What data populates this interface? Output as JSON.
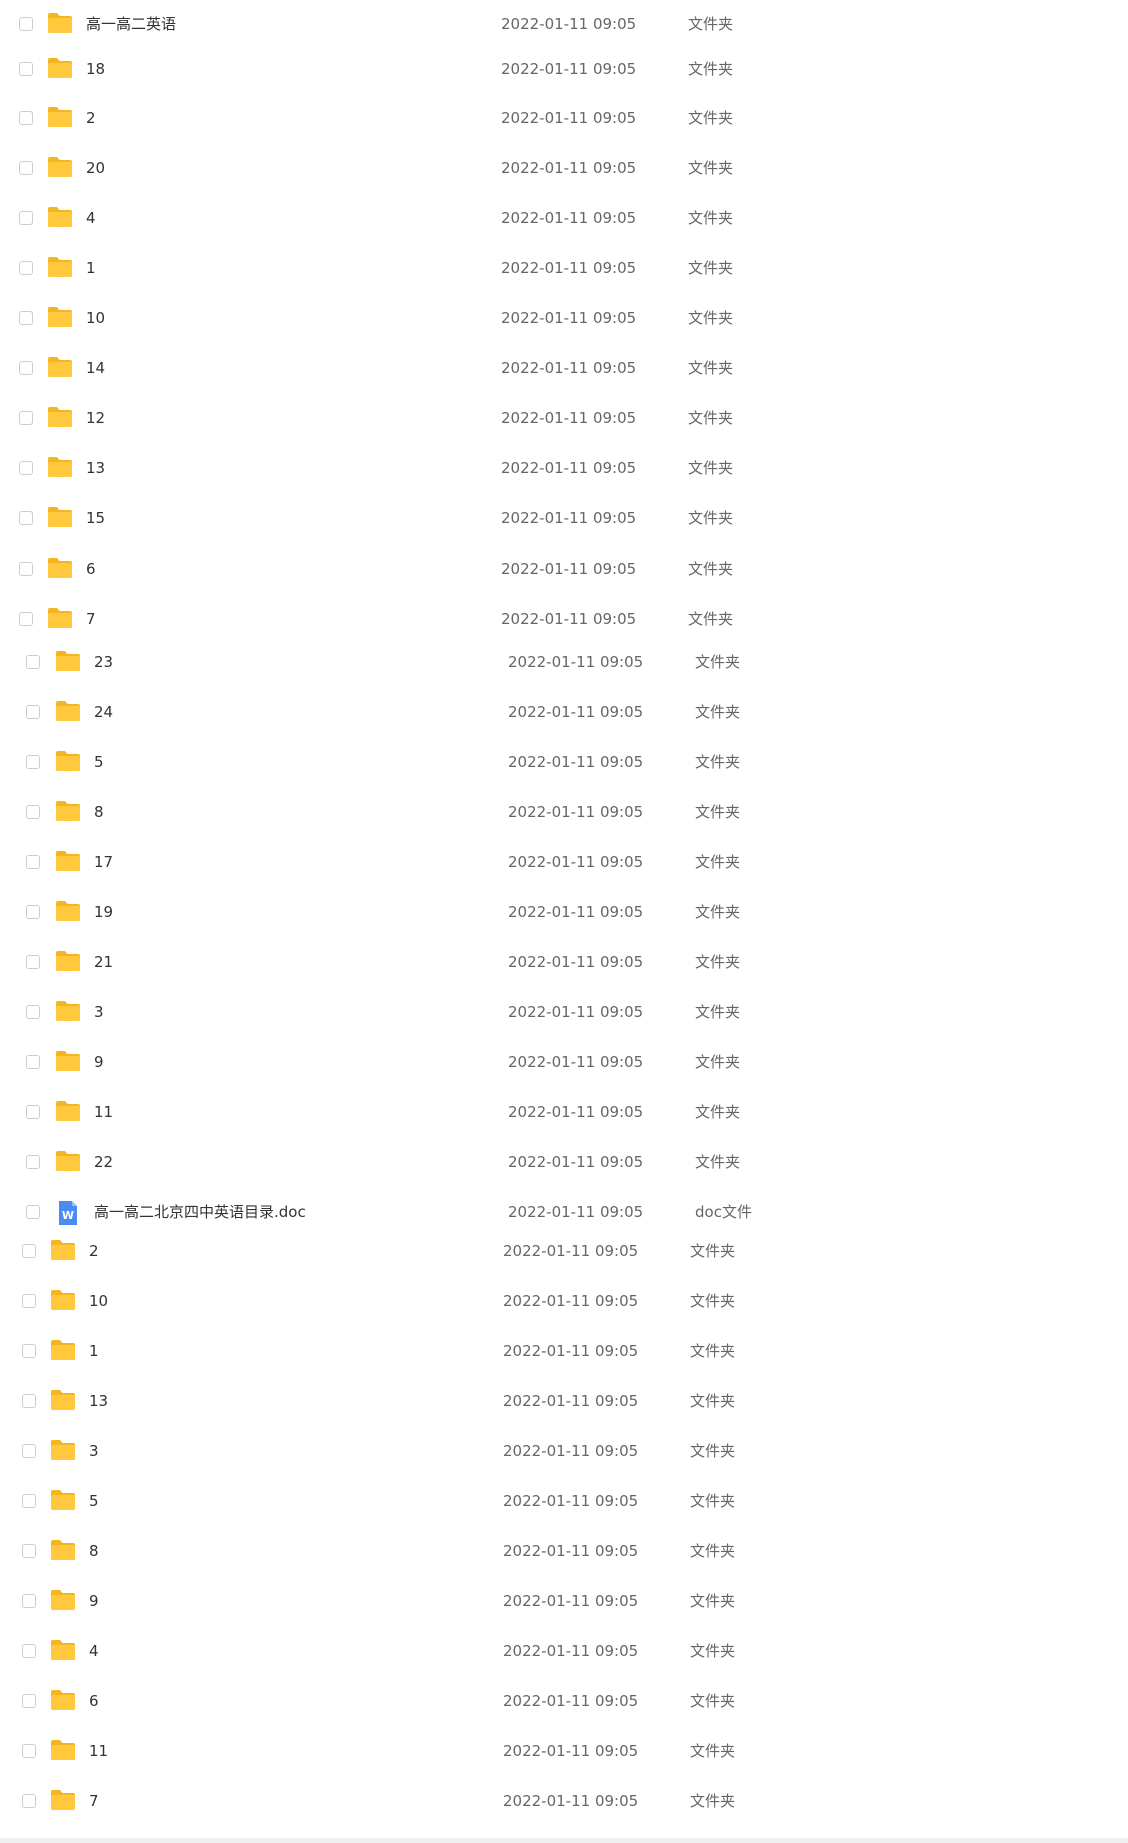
{
  "colors": {
    "folder": "#FFC83D",
    "folder_tab": "#F5B520",
    "doc_icon": "#4C8BF5",
    "date_text": "#666666",
    "name_text": "#333333"
  },
  "icons": {
    "folder": "folder-icon",
    "doc": "word-doc-icon",
    "checkbox": "checkbox"
  },
  "rows": [
    {
      "name": "高一高二英语",
      "date": "2022-01-11 09:05",
      "type": "文件夹"
    },
    {
      "name": "18",
      "date": "2022-01-11 09:05",
      "type": "文件夹"
    },
    {
      "name": "2",
      "date": "2022-01-11 09:05",
      "type": "文件夹"
    },
    {
      "name": "20",
      "date": "2022-01-11 09:05",
      "type": "文件夹"
    },
    {
      "name": "4",
      "date": "2022-01-11 09:05",
      "type": "文件夹"
    },
    {
      "name": "1",
      "date": "2022-01-11 09:05",
      "type": "文件夹"
    },
    {
      "name": "10",
      "date": "2022-01-11 09:05",
      "type": "文件夹"
    },
    {
      "name": "14",
      "date": "2022-01-11 09:05",
      "type": "文件夹"
    },
    {
      "name": "12",
      "date": "2022-01-11 09:05",
      "type": "文件夹"
    },
    {
      "name": "13",
      "date": "2022-01-11 09:05",
      "type": "文件夹"
    },
    {
      "name": "15",
      "date": "2022-01-11 09:05",
      "type": "文件夹"
    },
    {
      "name": "6",
      "date": "2022-01-11 09:05",
      "type": "文件夹"
    },
    {
      "name": "7",
      "date": "2022-01-11 09:05",
      "type": "文件夹"
    },
    {
      "name": "23",
      "date": "2022-01-11 09:05",
      "type": "文件夹"
    },
    {
      "name": "24",
      "date": "2022-01-11 09:05",
      "type": "文件夹"
    },
    {
      "name": "5",
      "date": "2022-01-11 09:05",
      "type": "文件夹"
    },
    {
      "name": "8",
      "date": "2022-01-11 09:05",
      "type": "文件夹"
    },
    {
      "name": "17",
      "date": "2022-01-11 09:05",
      "type": "文件夹"
    },
    {
      "name": "19",
      "date": "2022-01-11 09:05",
      "type": "文件夹"
    },
    {
      "name": "21",
      "date": "2022-01-11 09:05",
      "type": "文件夹"
    },
    {
      "name": "3",
      "date": "2022-01-11 09:05",
      "type": "文件夹"
    },
    {
      "name": "9",
      "date": "2022-01-11 09:05",
      "type": "文件夹"
    },
    {
      "name": "11",
      "date": "2022-01-11 09:05",
      "type": "文件夹"
    },
    {
      "name": "22",
      "date": "2022-01-11 09:05",
      "type": "文件夹"
    },
    {
      "name": "高一高二北京四中英语目录.doc",
      "date": "2022-01-11 09:05",
      "type": "doc文件"
    },
    {
      "name": "2",
      "date": "2022-01-11 09:05",
      "type": "文件夹"
    },
    {
      "name": "10",
      "date": "2022-01-11 09:05",
      "type": "文件夹"
    },
    {
      "name": "1",
      "date": "2022-01-11 09:05",
      "type": "文件夹"
    },
    {
      "name": "13",
      "date": "2022-01-11 09:05",
      "type": "文件夹"
    },
    {
      "name": "3",
      "date": "2022-01-11 09:05",
      "type": "文件夹"
    },
    {
      "name": "5",
      "date": "2022-01-11 09:05",
      "type": "文件夹"
    },
    {
      "name": "8",
      "date": "2022-01-11 09:05",
      "type": "文件夹"
    },
    {
      "name": "9",
      "date": "2022-01-11 09:05",
      "type": "文件夹"
    },
    {
      "name": "4",
      "date": "2022-01-11 09:05",
      "type": "文件夹"
    },
    {
      "name": "6",
      "date": "2022-01-11 09:05",
      "type": "文件夹"
    },
    {
      "name": "11",
      "date": "2022-01-11 09:05",
      "type": "文件夹"
    },
    {
      "name": "7",
      "date": "2022-01-11 09:05",
      "type": "文件夹"
    }
  ]
}
